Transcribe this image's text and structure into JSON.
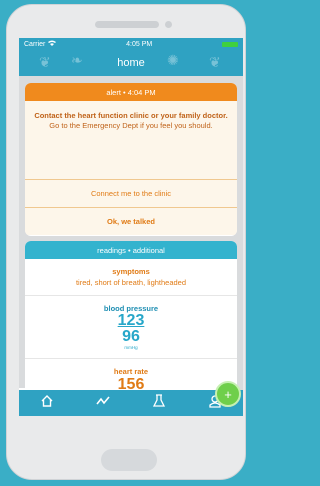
{
  "status_bar": {
    "carrier": "Carrier",
    "time": "4:05 PM"
  },
  "nav": {
    "title": "home"
  },
  "alert": {
    "header": "alert • 4:04 PM",
    "message_bold": "Contact the heart function clinic or your family doctor.",
    "message": "Go to the Emergency Dept if you feel you should.",
    "action_connect": "Connect me to the clinic",
    "action_ok": "Ok, we talked"
  },
  "readings": {
    "header": "readings • additional",
    "symptoms_title": "symptoms",
    "symptoms_value": "tired, short of breath, lightheaded",
    "bp_title": "blood pressure",
    "bp_systolic": "123",
    "bp_diastolic": "96",
    "bp_unit": "mmHg",
    "hr_title": "heart rate",
    "hr_value": "156"
  },
  "fab": {
    "label": "+"
  },
  "tabs": [
    {
      "icon": "home-icon"
    },
    {
      "icon": "trend-icon"
    },
    {
      "icon": "flask-icon"
    },
    {
      "icon": "user-icon"
    }
  ],
  "colors": {
    "primary": "#2fa2c2",
    "alert": "#f08a1d",
    "fab": "#6fcf4b"
  }
}
